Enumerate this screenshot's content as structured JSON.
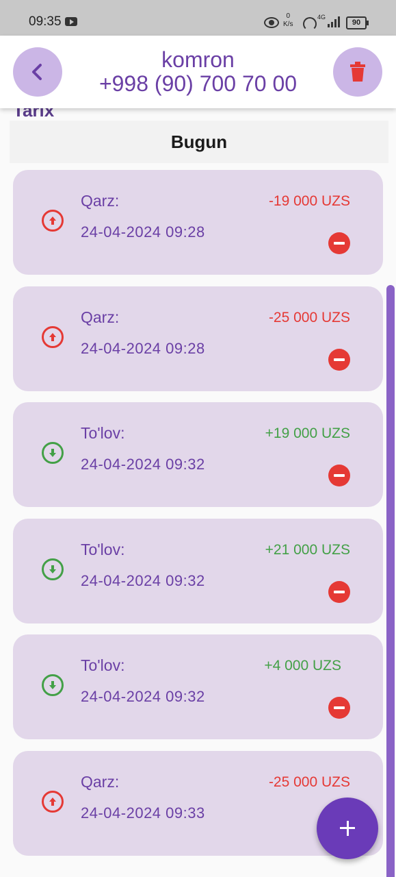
{
  "status_bar": {
    "time": "09:35",
    "speed_value": "0",
    "speed_unit": "K/s",
    "network": "4G",
    "battery": "90"
  },
  "header": {
    "name": "komron",
    "phone": "+998 (90) 700 70 00"
  },
  "partial_label": "Tarix",
  "section": {
    "title": "Bugun"
  },
  "transactions": [
    {
      "label": "Qarz:",
      "amount": "-19 000 UZS",
      "date": "24-04-2024 09:28",
      "direction": "up"
    },
    {
      "label": "Qarz:",
      "amount": "-25 000 UZS",
      "date": "24-04-2024 09:28",
      "direction": "up"
    },
    {
      "label": "To'lov:",
      "amount": "+19 000 UZS",
      "date": "24-04-2024 09:32",
      "direction": "down"
    },
    {
      "label": "To'lov:",
      "amount": "+21 000 UZS",
      "date": "24-04-2024 09:32",
      "direction": "down"
    },
    {
      "label": "To'lov:",
      "amount": "+4 000 UZS",
      "date": "24-04-2024 09:32",
      "direction": "down"
    },
    {
      "label": "Qarz:",
      "amount": "-25 000 UZS",
      "date": "24-04-2024 09:33",
      "direction": "up"
    }
  ],
  "colors": {
    "accent": "#6a3fa5",
    "card": "#e2d7ea",
    "debt": "#e53935",
    "payment": "#43a047"
  },
  "icons": {
    "back": "chevron-left-icon",
    "delete": "trash-icon",
    "debt": "arrow-up-circle-icon",
    "payment": "arrow-down-circle-icon",
    "remove": "minus-circle-icon",
    "add": "plus-icon"
  }
}
